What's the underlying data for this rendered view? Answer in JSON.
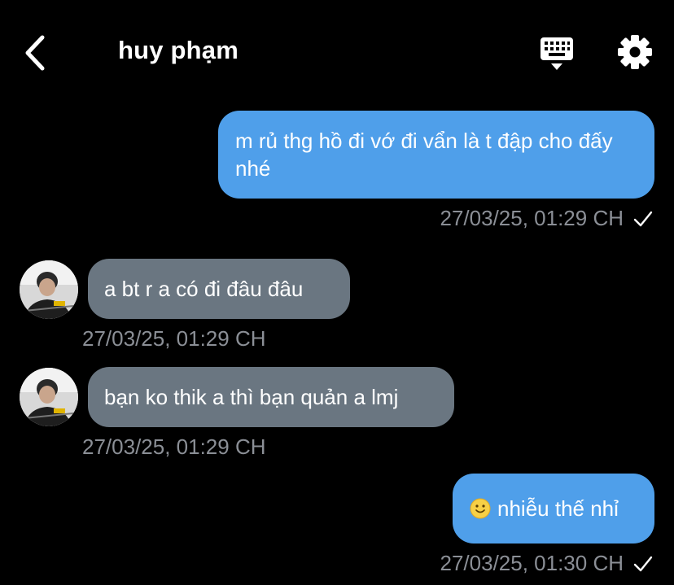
{
  "header": {
    "title": "huy phạm"
  },
  "messages": [
    {
      "direction": "outgoing",
      "text": "m rủ thg hồ đi vớ đi vẩn là t đập cho đấy nhé",
      "timestamp": "27/03/25, 01:29 CH",
      "status_icon": "check-icon"
    },
    {
      "direction": "incoming",
      "text": "a bt r a có đi đâu đâu",
      "timestamp": "27/03/25, 01:29 CH"
    },
    {
      "direction": "incoming",
      "text": "bạn ko thik a thì bạn quản a lmj",
      "timestamp": "27/03/25, 01:29 CH"
    },
    {
      "direction": "outgoing",
      "emoji": "slightly-smiling-face",
      "text": "nhiễu thế nhỉ",
      "timestamp": "27/03/25, 01:30 CH",
      "status_icon": "check-icon"
    }
  ],
  "colors": {
    "background": "#000000",
    "outgoing_bubble": "#4f9fea",
    "incoming_bubble": "#6a7681",
    "timestamp": "#8b8f96"
  }
}
